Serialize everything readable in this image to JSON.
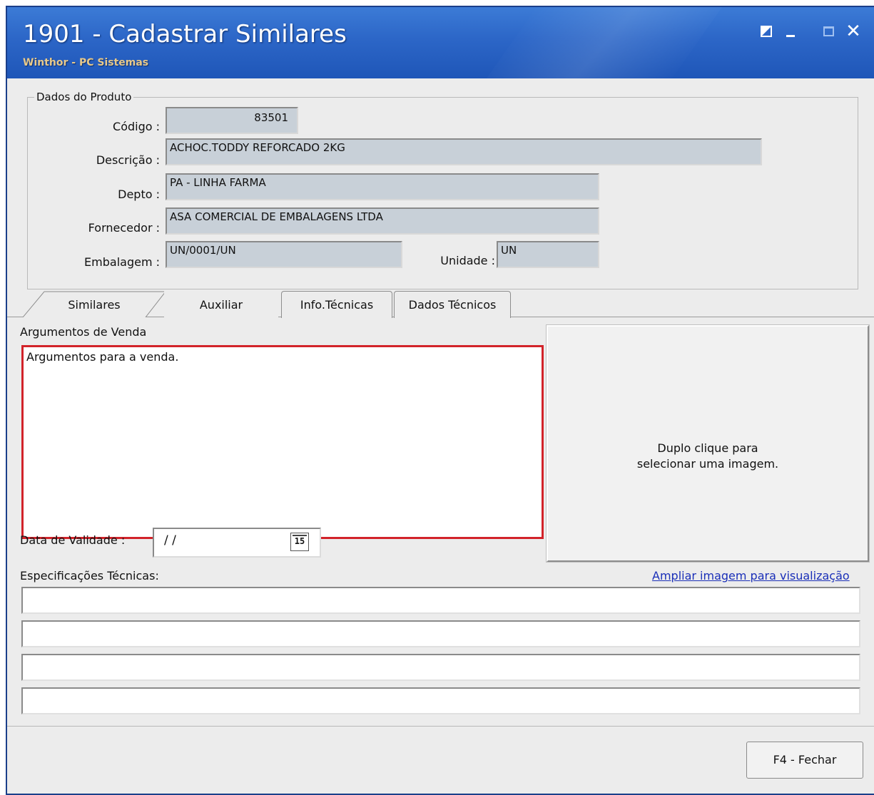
{
  "window": {
    "title": "1901 - Cadastrar Similares",
    "subtitle": "Winthor - PC Sistemas",
    "controls": [
      "restore-icon",
      "minimize-icon",
      "maximize-icon",
      "close-icon"
    ],
    "close_glyph": "✕",
    "title_bar_color": "#2c66c7"
  },
  "produto": {
    "legend": "Dados do Produto",
    "codigo_label": "Código :",
    "codigo_value": "83501",
    "descricao_label": "Descrição :",
    "descricao_value": "ACHOC.TODDY REFORCADO 2KG",
    "depto_label": "Depto :",
    "depto_value": "PA - LINHA FARMA",
    "fornecedor_label": "Fornecedor :",
    "fornecedor_value": "ASA COMERCIAL DE EMBALAGENS LTDA",
    "embalagem_label": "Embalagem :",
    "embalagem_value": "UN/0001/UN",
    "unidade_label": "Unidade :",
    "unidade_value": "UN"
  },
  "tabs": [
    {
      "label": "Similares",
      "active": false
    },
    {
      "label": "Auxiliar",
      "active": true
    },
    {
      "label": "Info.Técnicas",
      "active": false
    },
    {
      "label": "Dados Técnicos",
      "active": false
    }
  ],
  "auxiliar": {
    "argumentos_label": "Argumentos de Venda",
    "argumentos_value": "Argumentos para a venda.",
    "highlight_color": "#d2232a",
    "image_hint_line1": "Duplo clique para",
    "image_hint_line2": "selecionar uma imagem.",
    "data_validade_label": "Data de Validade :",
    "data_validade_value": "/ /",
    "calendar_icon_text": "15",
    "especificacoes_label": "Especificações Técnicas:",
    "ampliar_link": "Ampliar imagem para visualização",
    "especificacoes_values": [
      "",
      "",
      "",
      ""
    ]
  },
  "footer": {
    "close_button": "F4 - Fechar"
  }
}
